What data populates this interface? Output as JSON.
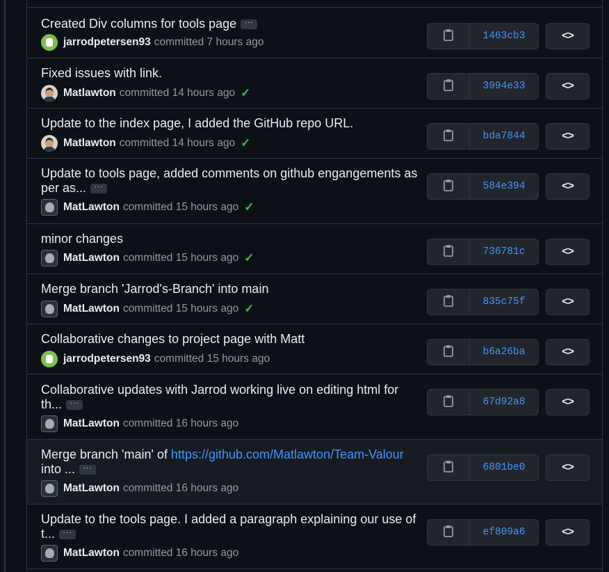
{
  "commits": [
    {
      "message": "Created Div columns for tools page",
      "link": "",
      "message_tail": "",
      "truncated": true,
      "author": "jarrodpetersen93",
      "avatar": "green-identicon",
      "time": "committed 7 hours ago",
      "check": false,
      "sha": "1463cb3"
    },
    {
      "message": "Fixed issues with link.",
      "link": "",
      "message_tail": "",
      "truncated": false,
      "author": "Matlawton",
      "avatar": "photo",
      "time": "committed 14 hours ago",
      "check": true,
      "sha": "3994e33"
    },
    {
      "message": "Update to the index page, I added the GitHub repo URL.",
      "link": "",
      "message_tail": "",
      "truncated": false,
      "author": "Matlawton",
      "avatar": "photo",
      "time": "committed 14 hours ago",
      "check": true,
      "sha": "bda7844"
    },
    {
      "message": "Update to tools page, added comments on github engangements as per as...",
      "link": "",
      "message_tail": "",
      "truncated": true,
      "author": "MatLawton",
      "avatar": "github-default",
      "time": "committed 15 hours ago",
      "check": true,
      "sha": "584e394"
    },
    {
      "message": "minor changes",
      "link": "",
      "message_tail": "",
      "truncated": false,
      "author": "MatLawton",
      "avatar": "github-default",
      "time": "committed 15 hours ago",
      "check": true,
      "sha": "736781c"
    },
    {
      "message": "Merge branch 'Jarrod's-Branch' into main",
      "link": "",
      "message_tail": "",
      "truncated": false,
      "author": "MatLawton",
      "avatar": "github-default",
      "time": "committed 15 hours ago",
      "check": true,
      "sha": "835c75f"
    },
    {
      "message": "Collaborative changes to project page with Matt",
      "link": "",
      "message_tail": "",
      "truncated": false,
      "author": "jarrodpetersen93",
      "avatar": "green-identicon",
      "time": "committed 15 hours ago",
      "check": false,
      "sha": "b6a26ba"
    },
    {
      "message": "Collaborative updates with Jarrod working live on editing html for th...",
      "link": "",
      "message_tail": "",
      "truncated": true,
      "author": "MatLawton",
      "avatar": "github-default",
      "time": "committed 16 hours ago",
      "check": false,
      "sha": "67d92a8"
    },
    {
      "message": "Merge branch 'main' of ",
      "link": "https://github.com/Matlawton/Team-Valour",
      "message_tail": " into ...",
      "truncated": true,
      "author": "MatLawton",
      "avatar": "github-default",
      "time": "committed 16 hours ago",
      "check": false,
      "sha": "6801be0",
      "highlighted": true
    },
    {
      "message": "Update to the tools page. I added a paragraph explaining our use of t...",
      "link": "",
      "message_tail": "",
      "truncated": true,
      "author": "MatLawton",
      "avatar": "github-default",
      "time": "committed 16 hours ago",
      "check": false,
      "sha": "ef809a6"
    }
  ],
  "ui": {
    "ellipsis_label": "···",
    "check_glyph": "✓",
    "browse_label": "<>",
    "icons": {
      "copy": "copy-icon",
      "check": "check-icon",
      "browse": "code-icon"
    },
    "colors": {
      "bg": "#0d1117",
      "link": "#4493f8",
      "success": "#3fb950",
      "muted": "#9198a1",
      "border": "#30363d"
    }
  }
}
